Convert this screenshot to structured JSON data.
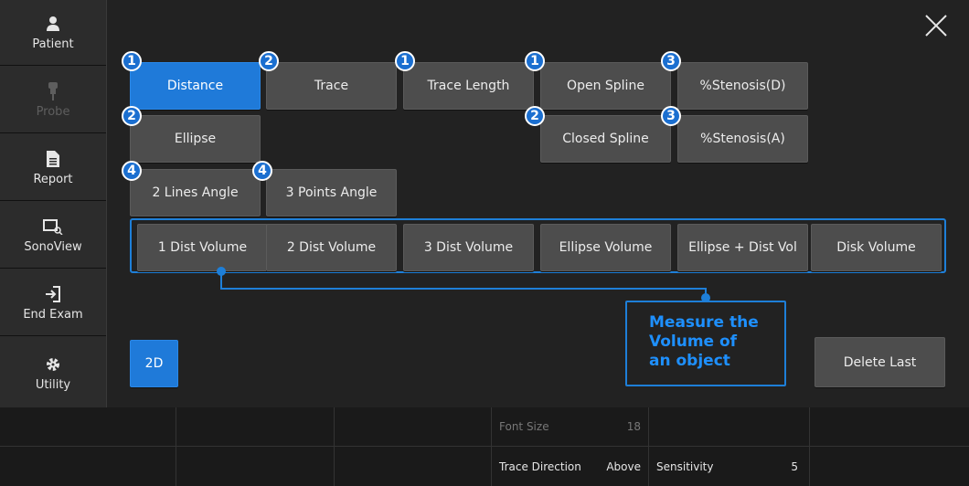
{
  "sidebar": {
    "items": [
      {
        "label": "Patient",
        "icon": "person-icon",
        "enabled": true
      },
      {
        "label": "Probe",
        "icon": "probe-icon",
        "enabled": false
      },
      {
        "label": "Report",
        "icon": "document-icon",
        "enabled": true
      },
      {
        "label": "SonoView",
        "icon": "image-search-icon",
        "enabled": true
      },
      {
        "label": "End Exam",
        "icon": "exit-arrow-icon",
        "enabled": true
      },
      {
        "label": "Utility",
        "icon": "gear-icon",
        "enabled": true
      }
    ]
  },
  "measurements": {
    "distance": {
      "label": "Distance",
      "badge": "1"
    },
    "trace": {
      "label": "Trace",
      "badge": "2"
    },
    "trace_length": {
      "label": "Trace Length",
      "badge": "1"
    },
    "open_spline": {
      "label": "Open Spline",
      "badge": "1"
    },
    "stenosis_d": {
      "label": "%Stenosis(D)",
      "badge": "3"
    },
    "ellipse": {
      "label": "Ellipse",
      "badge": "2"
    },
    "closed_spline": {
      "label": "Closed Spline",
      "badge": "2"
    },
    "stenosis_a": {
      "label": "%Stenosis(A)",
      "badge": "3"
    },
    "lines_angle": {
      "label": "2 Lines Angle",
      "badge": "4"
    },
    "points_angle": {
      "label": "3 Points Angle",
      "badge": "4"
    }
  },
  "volume": {
    "items": [
      "1 Dist Volume",
      "2 Dist Volume",
      "3 Dist Volume",
      "Ellipse Volume",
      "Ellipse + Dist Vol",
      "Disk Volume"
    ]
  },
  "callout": {
    "lines": [
      "Measure the",
      "Volume of",
      "an object"
    ]
  },
  "mode_button": {
    "label": "2D"
  },
  "delete_button": {
    "label": "Delete Last"
  },
  "bottom_bar": {
    "font_size": {
      "label": "Font Size",
      "value": "18"
    },
    "trace_direction": {
      "label": "Trace Direction",
      "value": "Above"
    },
    "sensitivity": {
      "label": "Sensitivity",
      "value": "5"
    }
  },
  "colors": {
    "accent": "#1f7ad9",
    "button": "#4d4d4d",
    "background": "#222222"
  }
}
